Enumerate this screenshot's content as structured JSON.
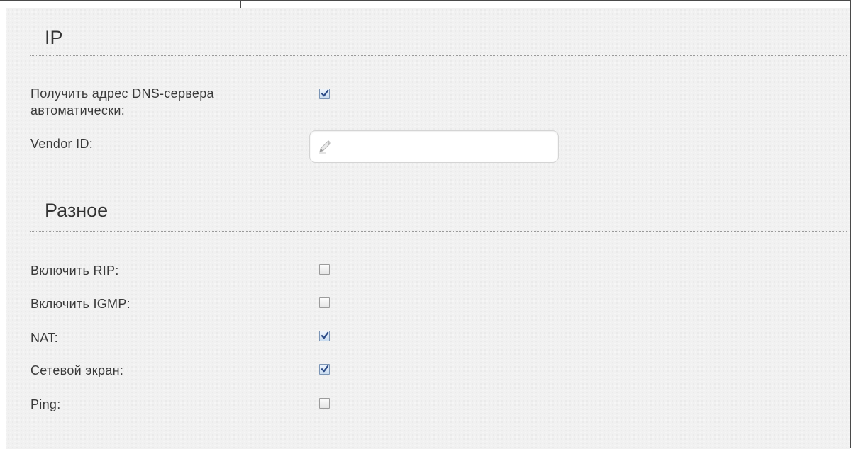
{
  "sections": {
    "ip": {
      "title": "IP"
    },
    "misc": {
      "title": "Разное"
    }
  },
  "ip_settings": {
    "auto_dns": {
      "label": "Получить адрес DNS-сервера автоматически:",
      "label_line1": "Получить адрес DNS-сервера",
      "label_line2": "автоматически:",
      "checked": true
    },
    "vendor_id": {
      "label": "Vendor ID:",
      "value": "",
      "placeholder": ""
    }
  },
  "misc_settings": {
    "rip": {
      "label": "Включить RIP:",
      "checked": false
    },
    "igmp": {
      "label": "Включить IGMP:",
      "checked": false
    },
    "nat": {
      "label": "NAT:",
      "checked": true
    },
    "firewall": {
      "label": "Сетевой экран:",
      "checked": true
    },
    "ping": {
      "label": "Ping:",
      "checked": false
    }
  },
  "icons": {
    "vendor_id_field": "pencil-icon",
    "checkbox_mark": "checkmark-icon"
  },
  "colors": {
    "panel_background": "#f1f1f1",
    "check_mark": "#2b4a86",
    "text": "#3a3a3a"
  }
}
